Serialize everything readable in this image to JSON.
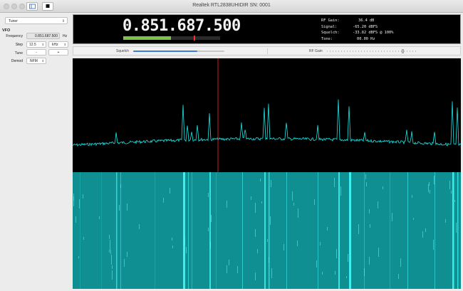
{
  "window": {
    "title": "Realtek RTL2838UHIDIR SN: 0001"
  },
  "sidebar": {
    "panel_select": "Tuner",
    "section": "VFO",
    "frequency": {
      "label": "Frequency",
      "value": "0.851.687.500",
      "unit": "Hz"
    },
    "step": {
      "label": "Step",
      "value": "12.5",
      "unit": "kHz"
    },
    "tune": {
      "label": "Tune",
      "minus": "-",
      "plus": "+"
    },
    "demod": {
      "label": "Demod",
      "value": "NFM"
    }
  },
  "display": {
    "frequency": "0.851.687.500",
    "signal_meter_level": 0.49,
    "squelch_marker": 0.73,
    "rf_gain_label": "RF Gain:",
    "rf_gain_value": "36.4 dB",
    "signal_label": "Signal:",
    "signal_value": "-65.20 dBFS",
    "squelch_label": "Squelch:",
    "squelch_value": "-33.82 dBFS @ 100%",
    "tone_label": "Tone:",
    "tone_value": "00.00 Hz"
  },
  "controls": {
    "squelch_label": "Squelch",
    "squelch_level": 0.7,
    "rf_gain_label": "RF Gain",
    "rf_gain_level": 0.83
  },
  "colors": {
    "trace": "#19e6e6",
    "waterfall_bg": "#0f8f91",
    "tuned_marker": "#cc1a1a",
    "meter": "#7ec24a",
    "accent": "#3b7ddd"
  }
}
